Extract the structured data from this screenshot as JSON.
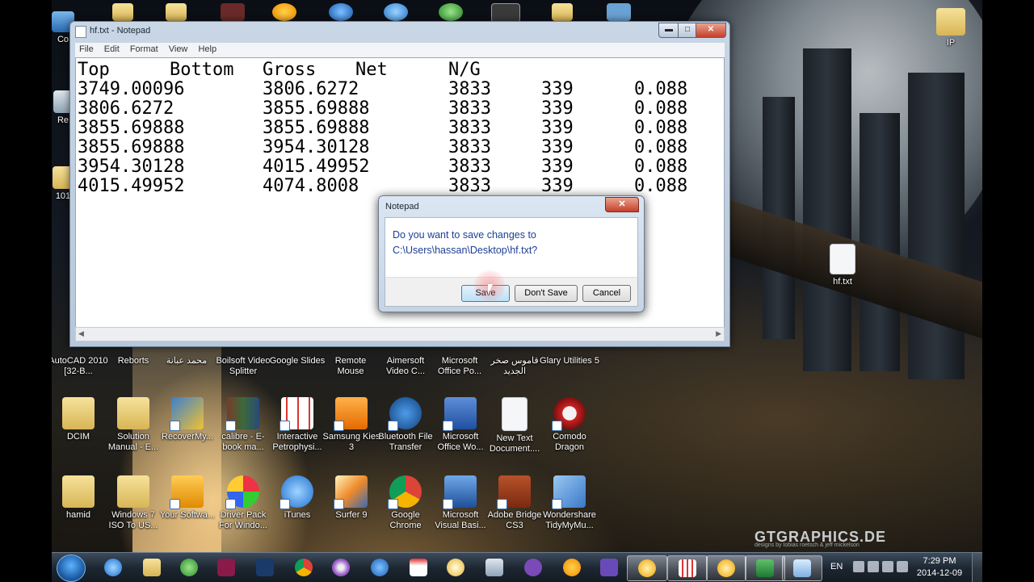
{
  "notepad": {
    "title": "hf.txt - Notepad",
    "buttons": {
      "minimize": "▬",
      "maximize": "□",
      "close": "✕"
    },
    "menu": [
      "File",
      "Edit",
      "Format",
      "View",
      "Help"
    ],
    "header": [
      "Top",
      "Bottom",
      "Gross",
      "Net",
      "N/G"
    ],
    "rows": [
      [
        "3749.00096",
        "3806.6272",
        "3833",
        "339",
        "0.088"
      ],
      [
        "3806.6272",
        "3855.69888",
        "3833",
        "339",
        "0.088"
      ],
      [
        "3855.69888",
        "3855.69888",
        "3833",
        "339",
        "0.088"
      ],
      [
        "3855.69888",
        "3954.30128",
        "3833",
        "339",
        "0.088"
      ],
      [
        "3954.30128",
        "4015.49952",
        "3833",
        "339",
        "0.088"
      ],
      [
        "4015.49952",
        "4074.8008",
        "3833",
        "339",
        "0.088"
      ]
    ]
  },
  "dialog": {
    "title": "Notepad",
    "close": "✕",
    "message_line1": "Do you want to save changes to",
    "message_line2": "C:\\Users\\hassan\\Desktop\\hf.txt?",
    "save": "Save",
    "dont_save": "Don't Save",
    "cancel": "Cancel"
  },
  "desktop": {
    "partial_labels": {
      "computer": "Co",
      "recycle": "Re",
      "folder101": "101"
    },
    "right_icons": {
      "ip": "IP",
      "hf": "hf.txt"
    },
    "row1": [
      "AutoCAD 2010 [32-B...",
      "Reborts",
      "محمد عبانة",
      "Boilsoft Video Splitter",
      "Google Slides",
      "Remote Mouse",
      "Aimersoft Video C...",
      "Microsoft Office Po...",
      "قاموس صخر الجديد",
      "Glary Utilities 5"
    ],
    "row2": [
      "DCIM",
      "Solution Manual - E...",
      "RecoverMy...",
      "calibre - E-book ma...",
      "Interactive Petrophysi...",
      "Samsung Kies 3",
      "Bluetooth File Transfer",
      "Microsoft Office Wo...",
      "New Text Document....",
      "Comodo Dragon"
    ],
    "row3": [
      "hamid",
      "Windows 7 ISO To US...",
      "Your Softwa...",
      "Driver Pack For Windo...",
      "iTunes",
      "Surfer 9",
      "Google Chrome",
      "Microsoft Visual Basi...",
      "Adobe Bridge CS3",
      "Wondershare TidyMyMu..."
    ],
    "watermark": "GTGRAPHICS.DE",
    "watermark_sub": "designs by tobias roetsch & jeff mickelson"
  },
  "taskbar": {
    "language": "EN",
    "time": "7:29 PM",
    "date": "2014-12-09"
  },
  "colors": {
    "dialog_text": "#1c3f94",
    "taskbar": "#1c2530",
    "close_red": "#c5402a"
  }
}
